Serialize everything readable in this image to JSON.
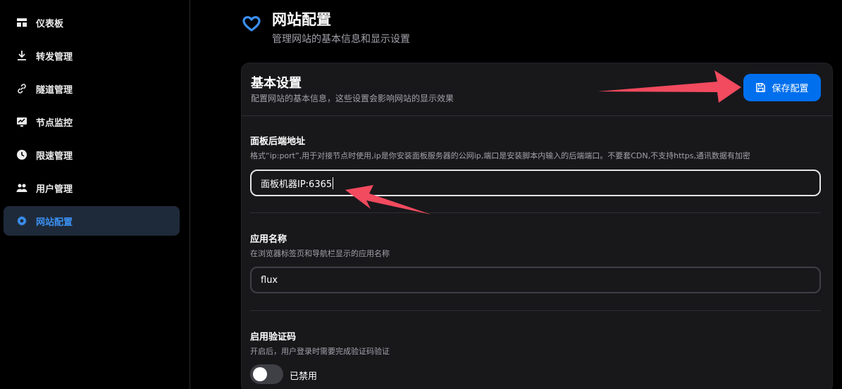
{
  "sidebar": {
    "items": [
      {
        "label": "仪表板",
        "icon": "dashboard-icon",
        "active": false
      },
      {
        "label": "转发管理",
        "icon": "download-icon",
        "active": false
      },
      {
        "label": "隧道管理",
        "icon": "link-icon",
        "active": false
      },
      {
        "label": "节点监控",
        "icon": "monitor-chart-icon",
        "active": false
      },
      {
        "label": "限速管理",
        "icon": "clock-icon",
        "active": false
      },
      {
        "label": "用户管理",
        "icon": "users-icon",
        "active": false
      },
      {
        "label": "网站配置",
        "icon": "gear-icon",
        "active": true
      }
    ]
  },
  "header": {
    "icon": "heart-icon",
    "title": "网站配置",
    "subtitle": "管理网站的基本信息和显示设置"
  },
  "card": {
    "title": "基本设置",
    "description": "配置网站的基本信息，这些设置会影响网站的显示效果",
    "save_label": "保存配置",
    "save_icon": "save-icon"
  },
  "fields": {
    "backend": {
      "label": "面板后端地址",
      "hint": "格式“ip:port”,用于对接节点时使用,ip是你安装面板服务器的公网ip,端口是安装脚本内输入的后端端口。不要套CDN,不支持https,通讯数据有加密",
      "value": "面板机器IP:6365"
    },
    "app_name": {
      "label": "应用名称",
      "hint": "在浏览器标签页和导航栏显示的应用名称",
      "value": "flux"
    },
    "captcha": {
      "label": "启用验证码",
      "hint": "开启后，用户登录时需要完成验证码验证",
      "state_label": "已禁用",
      "enabled": false
    }
  },
  "colors": {
    "accent": "#006fee",
    "active_nav_bg": "#1e2a3a",
    "annotation_arrow": "#f24a5e"
  }
}
